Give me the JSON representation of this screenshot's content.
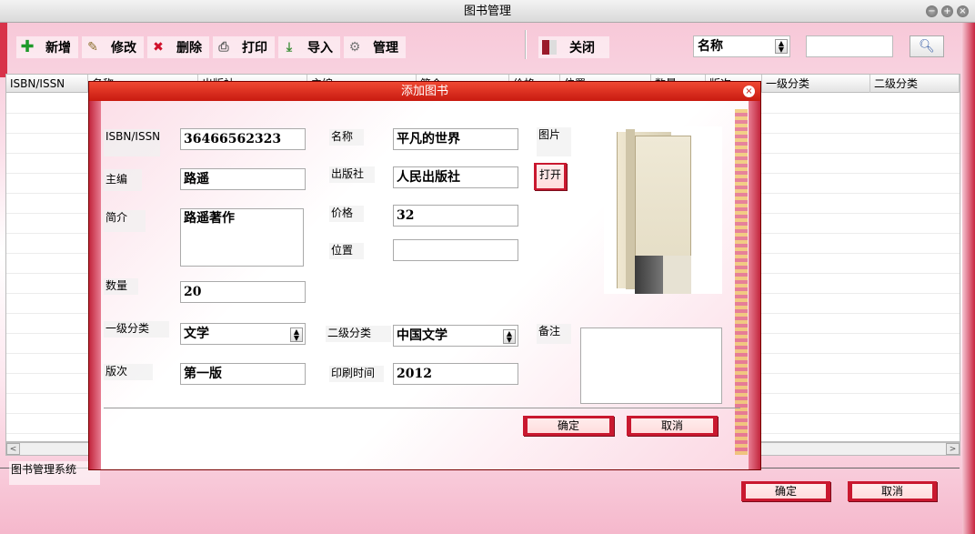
{
  "window": {
    "title": "图书管理"
  },
  "toolbar": {
    "add": "新增",
    "edit": "修改",
    "delete": "删除",
    "print": "打印",
    "import": "导入",
    "manage": "管理",
    "close": "关闭"
  },
  "search": {
    "field": "名称",
    "query": ""
  },
  "table": {
    "headers": [
      "ISBN/ISSN",
      "名称",
      "出版社",
      "主编",
      "简介",
      "价格",
      "位置",
      "数量",
      "版次",
      "一级分类",
      "二级分类"
    ]
  },
  "status": {
    "system_name": "图书管理系统"
  },
  "footer": {
    "ok": "确定",
    "cancel": "取消"
  },
  "dialog": {
    "title": "添加图书",
    "labels": {
      "isbn": "ISBN/ISSN",
      "name": "名称",
      "image": "图片",
      "editor": "主编",
      "publisher": "出版社",
      "summary": "简介",
      "price": "价格",
      "location": "位置",
      "quantity": "数量",
      "category1": "一级分类",
      "category2": "二级分类",
      "remark": "备注",
      "edition": "版次",
      "print_date": "印刷时间"
    },
    "values": {
      "isbn": "36466562323",
      "name": "平凡的世界",
      "editor": "路遥",
      "publisher": "人民出版社",
      "summary": "路遥著作",
      "price": "32",
      "location": "",
      "quantity": "20",
      "category1": "文学",
      "category2": "中国文学",
      "remark": "",
      "edition": "第一版",
      "print_date": "2012"
    },
    "open_button": "打开",
    "ok_button": "确定",
    "cancel_button": "取消"
  }
}
